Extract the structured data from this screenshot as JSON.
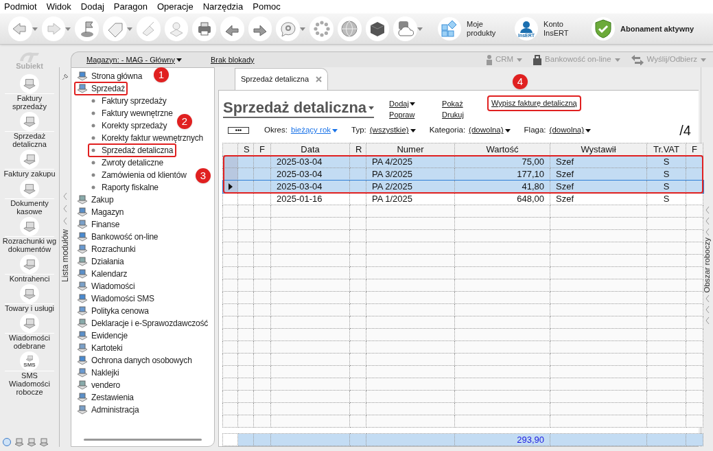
{
  "menu": [
    "Podmiot",
    "Widok",
    "Dodaj",
    "Paragon",
    "Operacje",
    "Narzędzia",
    "Pomoc"
  ],
  "toolbar": {
    "labeled": [
      {
        "label": "Moje produkty",
        "kind": "tiles"
      },
      {
        "label": "Konto InsERT",
        "kind": "account",
        "badge": "InsERT"
      },
      {
        "label": "Abonament aktywny",
        "kind": "shield"
      }
    ]
  },
  "app_logo": {
    "text": "Subiekt"
  },
  "nav": [
    {
      "label": "Faktury sprzedaży"
    },
    {
      "label": "Sprzedaż detaliczna"
    },
    {
      "label": "Faktury zakupu"
    },
    {
      "label": "Dokumenty kasowe"
    },
    {
      "label": "Rozrachunki wg dokumentów"
    },
    {
      "label": "Kontrahenci"
    },
    {
      "label": "Towary i usługi"
    },
    {
      "label": "Wiadomości odebrane"
    },
    {
      "label": "SMS Wiadomości robocze",
      "badge": "SMS"
    }
  ],
  "top_strip": {
    "warehouse": "Magazyn: - MAG - Główny",
    "lock": "Brak blokady",
    "right": [
      {
        "label": "CRM",
        "disabled": true
      },
      {
        "label": "Bankowość on-line",
        "disabled": true
      },
      {
        "label": "Wyślij/Odbierz",
        "disabled": true
      }
    ]
  },
  "module_strip": {
    "label": "Lista modułów"
  },
  "tree": [
    {
      "label": "Strona główna",
      "highlighted": false
    },
    {
      "label": "Sprzedaż",
      "highlighted": true,
      "children": [
        {
          "label": "Faktury sprzedaży",
          "highlighted": false
        },
        {
          "label": "Faktury wewnętrzne",
          "highlighted": false
        },
        {
          "label": "Korekty sprzedaży",
          "highlighted": false
        },
        {
          "label": "Korekty faktur wewnętrznych",
          "highlighted": false
        },
        {
          "label": "Sprzedaż detaliczna",
          "highlighted": true
        },
        {
          "label": "Zwroty detaliczne",
          "highlighted": false
        },
        {
          "label": "Zamówienia od klientów",
          "highlighted": false
        },
        {
          "label": "Raporty fiskalne",
          "highlighted": false
        }
      ]
    },
    {
      "label": "Zakup",
      "highlighted": false
    },
    {
      "label": "Magazyn",
      "highlighted": false
    },
    {
      "label": "Finanse",
      "highlighted": false
    },
    {
      "label": "Bankowość on-line",
      "highlighted": false
    },
    {
      "label": "Rozrachunki",
      "highlighted": false
    },
    {
      "label": "Działania",
      "highlighted": false
    },
    {
      "label": "Kalendarz",
      "highlighted": false
    },
    {
      "label": "Wiadomości",
      "highlighted": false
    },
    {
      "label": "Wiadomości SMS",
      "highlighted": false
    },
    {
      "label": "Polityka cenowa",
      "highlighted": false
    },
    {
      "label": "Deklaracje i e-Sprawozdawczość",
      "highlighted": false
    },
    {
      "label": "Ewidencje",
      "highlighted": false
    },
    {
      "label": "Kartoteki",
      "highlighted": false
    },
    {
      "label": "Ochrona danych osobowych",
      "highlighted": false
    },
    {
      "label": "Naklejki",
      "highlighted": false
    },
    {
      "label": "vendero",
      "highlighted": false
    },
    {
      "label": "Zestawienia",
      "highlighted": false
    },
    {
      "label": "Administracja",
      "highlighted": false
    }
  ],
  "tabs": [
    {
      "label": "Sprzedaż detaliczna",
      "selected": true
    }
  ],
  "view": {
    "title": "Sprzedaż detaliczna",
    "actions": [
      {
        "label": "Dodaj",
        "dropdown": true,
        "highlighted": false
      },
      {
        "label": "Popraw",
        "dropdown": false,
        "highlighted": false
      },
      {
        "label": "Pokaż",
        "dropdown": false,
        "highlighted": false
      },
      {
        "label": "Drukuj",
        "dropdown": false,
        "highlighted": false
      },
      {
        "label": "Wypisz fakturę detaliczną",
        "dropdown": false,
        "highlighted": true
      }
    ],
    "more_button": "•••",
    "filters": [
      {
        "label": "Okres:",
        "value": "bieżący rok",
        "kind": "accent"
      },
      {
        "label": "Typ:",
        "value": "(wszystkie)",
        "kind": "plain"
      },
      {
        "label": "Kategoria:",
        "value": "(dowolna)",
        "kind": "plain"
      },
      {
        "label": "Flaga:",
        "value": "(dowolna)",
        "kind": "plain"
      }
    ],
    "count": "/4"
  },
  "workspace_strip": {
    "label": "Obszar roboczy"
  },
  "table": {
    "columns": [
      "S",
      "F",
      "Data",
      "R",
      "Numer",
      "Wartość",
      "Wystawił",
      "Tr.VAT",
      "F"
    ],
    "rows": [
      {
        "data": "2025-03-04",
        "numer": "PA 4/2025",
        "wartosc": "75,00",
        "wystawil": "Szef",
        "tr_vat": "S",
        "selected": true,
        "current": false,
        "highlighted": true
      },
      {
        "data": "2025-03-04",
        "numer": "PA 3/2025",
        "wartosc": "177,10",
        "wystawil": "Szef",
        "tr_vat": "S",
        "selected": true,
        "current": false,
        "highlighted": true
      },
      {
        "data": "2025-03-04",
        "numer": "PA 2/2025",
        "wartosc": "41,80",
        "wystawil": "Szef",
        "tr_vat": "S",
        "selected": true,
        "current": true,
        "highlighted": true
      },
      {
        "data": "2025-01-16",
        "numer": "PA 1/2025",
        "wartosc": "648,00",
        "wystawil": "Szef",
        "tr_vat": "S",
        "selected": false,
        "current": false,
        "highlighted": false
      }
    ],
    "total": "293,90"
  },
  "callouts": [
    {
      "number": "1"
    },
    {
      "number": "2"
    },
    {
      "number": "3"
    },
    {
      "number": "4"
    }
  ]
}
